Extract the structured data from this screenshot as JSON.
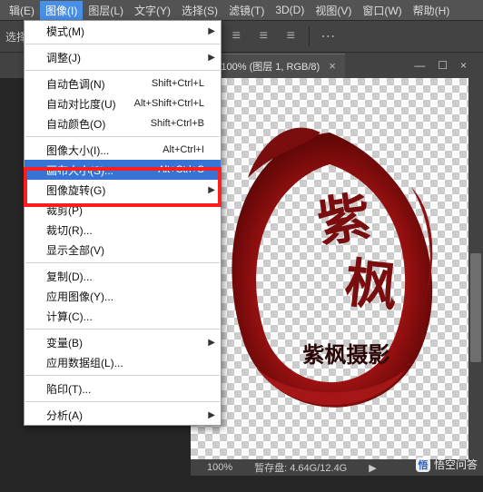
{
  "menubar": {
    "items": [
      {
        "label": "辑(E)"
      },
      {
        "label": "图像(I)"
      },
      {
        "label": "图层(L)"
      },
      {
        "label": "文字(Y)"
      },
      {
        "label": "选择(S)"
      },
      {
        "label": "滤镜(T)"
      },
      {
        "label": "3D(D)"
      },
      {
        "label": "视图(V)"
      },
      {
        "label": "窗口(W)"
      },
      {
        "label": "帮助(H)"
      }
    ]
  },
  "toolbar": {
    "label": "选择:"
  },
  "document": {
    "tab_title": "g @ 100% (图层 1, RGB/8)",
    "logo_caption": "紫枫摄影"
  },
  "status": {
    "zoom": "100%",
    "scratch": "暂存盘: 4.64G/12.4G"
  },
  "watermark": {
    "text": "悟空问答"
  },
  "menu": {
    "mode": {
      "label": "模式(M)",
      "arrow": "▶"
    },
    "adjust": {
      "label": "调整(J)",
      "arrow": "▶"
    },
    "auto_tone": {
      "label": "自动色调(N)",
      "shortcut": "Shift+Ctrl+L"
    },
    "auto_contrast": {
      "label": "自动对比度(U)",
      "shortcut": "Alt+Shift+Ctrl+L"
    },
    "auto_color": {
      "label": "自动颜色(O)",
      "shortcut": "Shift+Ctrl+B"
    },
    "image_size": {
      "label": "图像大小(I)...",
      "shortcut": "Alt+Ctrl+I"
    },
    "canvas_size": {
      "label": "画布大小(S)...",
      "shortcut": "Alt+Ctrl+C"
    },
    "rotate": {
      "label": "图像旋转(G)",
      "arrow": "▶"
    },
    "crop": {
      "label": "裁剪(P)"
    },
    "trim": {
      "label": "裁切(R)..."
    },
    "reveal_all": {
      "label": "显示全部(V)"
    },
    "duplicate": {
      "label": "复制(D)..."
    },
    "apply_image": {
      "label": "应用图像(Y)..."
    },
    "calculations": {
      "label": "计算(C)..."
    },
    "variables": {
      "label": "变量(B)",
      "arrow": "▶"
    },
    "apply_dataset": {
      "label": "应用数据组(L)..."
    },
    "trap": {
      "label": "陷印(T)..."
    },
    "analysis": {
      "label": "分析(A)",
      "arrow": "▶"
    }
  }
}
